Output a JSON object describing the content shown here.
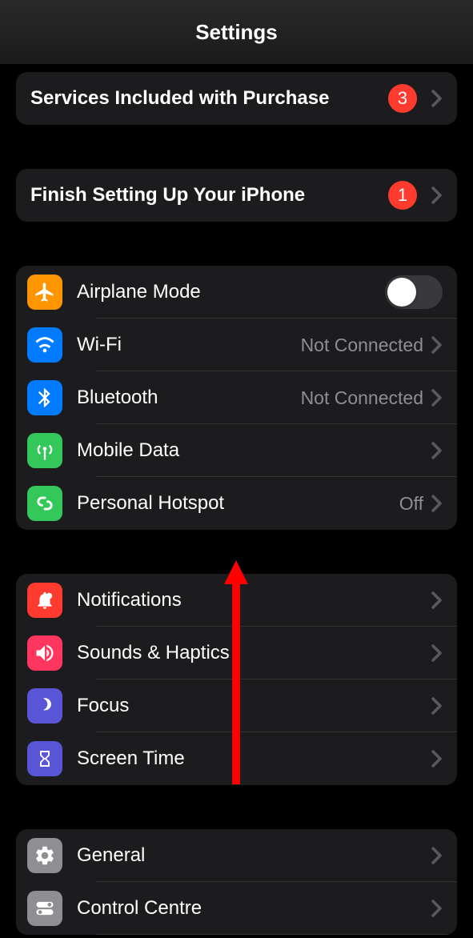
{
  "header": {
    "title": "Settings"
  },
  "section1": {
    "items": [
      {
        "label": "Services Included with Purchase",
        "badge": "3"
      }
    ]
  },
  "section2": {
    "items": [
      {
        "label": "Finish Setting Up Your iPhone",
        "badge": "1"
      }
    ]
  },
  "section3": {
    "items": [
      {
        "label": "Airplane Mode"
      },
      {
        "label": "Wi-Fi",
        "value": "Not Connected"
      },
      {
        "label": "Bluetooth",
        "value": "Not Connected"
      },
      {
        "label": "Mobile Data"
      },
      {
        "label": "Personal Hotspot",
        "value": "Off"
      }
    ]
  },
  "section4": {
    "items": [
      {
        "label": "Notifications"
      },
      {
        "label": "Sounds & Haptics"
      },
      {
        "label": "Focus"
      },
      {
        "label": "Screen Time"
      }
    ]
  },
  "section5": {
    "items": [
      {
        "label": "General"
      },
      {
        "label": "Control Centre"
      }
    ]
  },
  "colors": {
    "orange": "#ff9500",
    "blue": "#007aff",
    "green": "#34c759",
    "red": "#ff3b30",
    "pink": "#ff375f",
    "indigo": "#5856d6",
    "gray": "#8e8e93"
  }
}
